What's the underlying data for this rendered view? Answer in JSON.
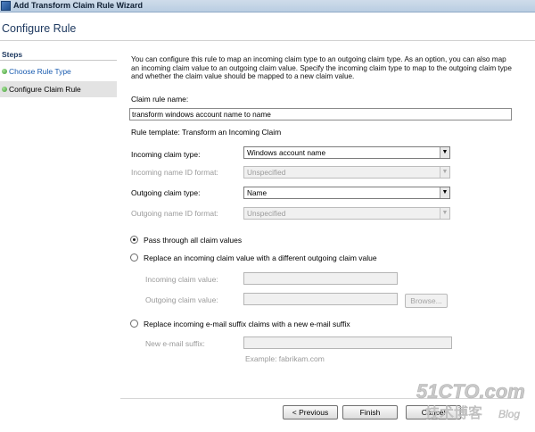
{
  "window": {
    "title": "Add Transform Claim Rule Wizard"
  },
  "header": {
    "page_title": "Configure Rule"
  },
  "sidebar": {
    "steps_label": "Steps",
    "items": [
      {
        "label": "Choose Rule Type"
      },
      {
        "label": "Configure Claim Rule"
      }
    ]
  },
  "main": {
    "description": "You can configure this rule to map an incoming claim type to an outgoing claim type. As an option, you can also map an incoming claim value to an outgoing claim value. Specify the incoming claim type to map to the outgoing claim type and whether the claim value should be mapped to a new claim value.",
    "rule_name_label": "Claim rule name:",
    "rule_name_value": "transform windows account name to name",
    "rule_template": "Rule template: Transform an Incoming Claim",
    "incoming_claim_type": {
      "label": "Incoming claim type:",
      "value": "Windows account name"
    },
    "incoming_name_id_format": {
      "label": "Incoming name ID format:",
      "value": "Unspecified"
    },
    "outgoing_claim_type": {
      "label": "Outgoing claim type:",
      "value": "Name"
    },
    "outgoing_name_id_format": {
      "label": "Outgoing name ID format:",
      "value": "Unspecified"
    },
    "options": {
      "pass_through": "Pass through all claim values",
      "replace_value": "Replace an incoming claim value with a different outgoing claim value",
      "incoming_value_label": "Incoming claim value:",
      "outgoing_value_label": "Outgoing claim value:",
      "browse_label": "Browse...",
      "replace_suffix": "Replace incoming e-mail suffix claims with a new e-mail suffix",
      "new_suffix_label": "New e-mail suffix:",
      "example": "Example: fabrikam.com"
    }
  },
  "footer": {
    "previous_label": "< Previous",
    "finish_label": "Finish",
    "cancel_label": "Cancel"
  },
  "watermark": {
    "brand": "51CTO.com",
    "sub_chars": "技术博客",
    "sub_latin": "Blog"
  },
  "colors": {
    "title_text": "#1f3a60",
    "link": "#1a5cb0",
    "step_dot": "#3f9a32",
    "watermark": "#c9c9c9"
  }
}
